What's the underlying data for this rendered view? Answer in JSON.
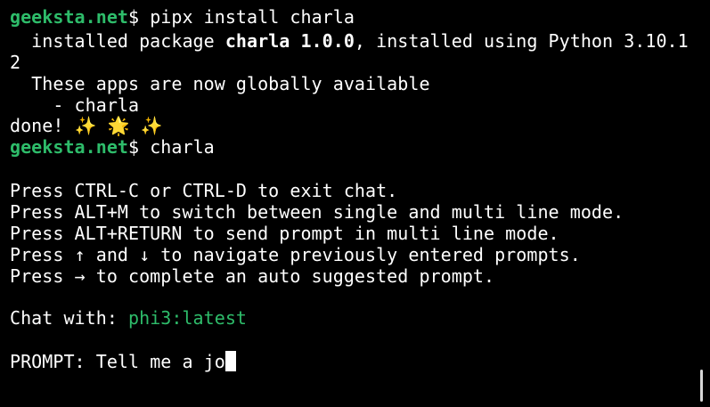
{
  "terminal": {
    "host_prompt": "geeksta.net",
    "prompt_symbol": "$ ",
    "command_1": "pipx install charla",
    "install_line_prefix": "  installed package ",
    "install_package": "charla 1.0.0",
    "install_line_suffix": ", installed using Python 3.10.1",
    "install_line_wrap": "2",
    "apps_available": "  These apps are now globally available",
    "app_item": "    - charla",
    "done_text": "done! ",
    "done_emojis": [
      "✨",
      "🌟",
      "✨"
    ],
    "command_2": "charla",
    "help_lines": [
      "Press CTRL-C or CTRL-D to exit chat.",
      "Press ALT+M to switch between single and multi line mode.",
      "Press ALT+RETURN to send prompt in multi line mode.",
      "Press ↑ and ↓ to navigate previously entered prompts.",
      "Press → to complete an auto suggested prompt."
    ],
    "chat_with_label": "Chat with: ",
    "model_name": "phi3:latest",
    "prompt_label": "PROMPT: ",
    "prompt_input": "Tell me a jo"
  },
  "colors": {
    "background": "#000000",
    "text": "#ffffff",
    "accent_green": "#2ebc6a"
  }
}
